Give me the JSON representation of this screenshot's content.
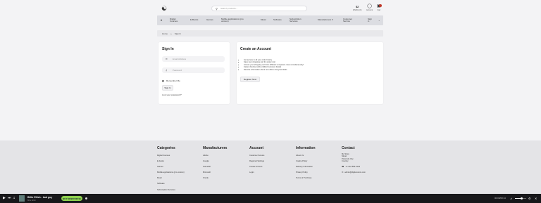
{
  "header": {
    "search_placeholder": "Search products...",
    "wishlist_label": "Wishlist (0)",
    "account_label": "Account",
    "cart_label": "Cart",
    "currency_label": "$2",
    "icons": {
      "logo": "shop-logo-icon",
      "search": "search-icon",
      "wishlist": "heart-icon",
      "account": "user-icon",
      "cart": "cart-icon"
    }
  },
  "nav": {
    "items": [
      {
        "label": "#"
      },
      {
        "label": "Digital Courses"
      },
      {
        "label": "E-Books"
      },
      {
        "label": "Games"
      },
      {
        "label": "Mobile applications (pro version)"
      },
      {
        "label": "Music"
      },
      {
        "label": "Software"
      },
      {
        "label": "Subscription Services"
      },
      {
        "label": "Manufacturers ▾"
      },
      {
        "label": "Customer Service"
      },
      {
        "label": "Sign in"
      }
    ]
  },
  "breadcrumb": {
    "home": "Home",
    "separator": "»",
    "current": "Sign In"
  },
  "signin": {
    "title": "Sign In",
    "email_placeholder": "Email Address",
    "password_placeholder": "Password",
    "remember_label": "Remember Me",
    "signin_button": "Sign In",
    "lost_password": "Lost your password?"
  },
  "create": {
    "title": "Create an Account",
    "bullets": [
      "Get access to all your order history",
      "Save your shopping cart for a later visit",
      "Access your shopping cart from different computers. Even simultaneously!",
      "Faster checkout with prefilled customer details",
      "Receive information about new offers and great deals"
    ],
    "register_button": "Register Now"
  },
  "footer": {
    "categories": {
      "title": "Categories",
      "links": [
        "Digital Courses",
        "E-books",
        "Games",
        "Mobile applications (pro version)",
        "Music",
        "Software",
        "Subscription Services"
      ]
    },
    "manufacturers": {
      "title": "Manufacturers",
      "links": [
        "Adobe",
        "Google",
        "Gameloft",
        "Microsoft",
        "Oracle"
      ]
    },
    "account": {
      "title": "Account",
      "links": [
        "Customer Service",
        "Regional Settings",
        "Create Account",
        "Login"
      ]
    },
    "information": {
      "title": "Information",
      "links": [
        "About Us",
        "Cookie Policy",
        "Delivery Information",
        "Privacy Policy",
        "Terms of Purchase"
      ]
    },
    "contact": {
      "title": "Contact",
      "lines": [
        "My Store",
        "Street",
        "Postcode City",
        "Country"
      ],
      "phone": "+1-212-555-0123",
      "email": "admin@digital-store.com"
    }
  },
  "player": {
    "track_title": "Billie Eilish - bad guy",
    "track_sub": "Billie Eilish",
    "pill_label": "BUY NOW FOR $1",
    "time": "00:00/03:14",
    "volume": 0.6,
    "colors": {
      "pill": "#8fd14f",
      "bar": "#17171a"
    }
  }
}
